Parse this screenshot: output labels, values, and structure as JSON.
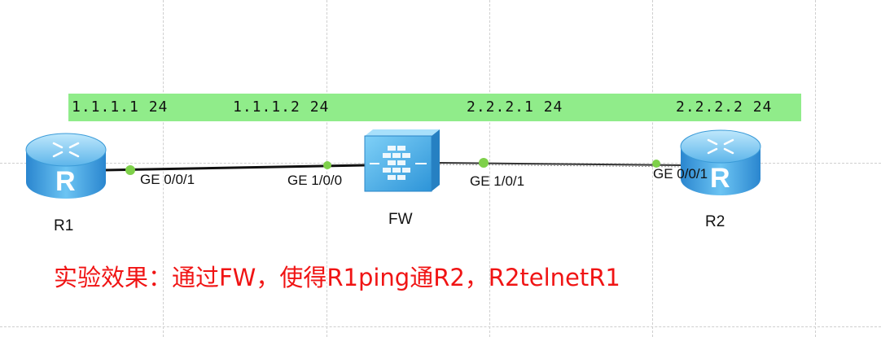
{
  "ip_labels": {
    "r1": "1.1.1.1 24",
    "fw_g100": "1.1.1.2 24",
    "fw_g101": "2.2.2.1 24",
    "r2": "2.2.2.2 24"
  },
  "ports": {
    "r1": "GE 0/0/1",
    "fw_left": "GE 1/0/0",
    "fw_right": "GE 1/0/1",
    "r2": "GE 0/0/1"
  },
  "devices": {
    "r1": "R1",
    "fw": "FW",
    "r2": "R2"
  },
  "router_glyph": "R",
  "note": "实验效果：通过FW，使得R1ping通R2，R2telnetR1",
  "colors": {
    "ip_band": "#90ec8a",
    "port_dot": "#7ed04a",
    "note": "#f01414",
    "router": "#3da3e0",
    "firewall": "#52b8ee"
  }
}
